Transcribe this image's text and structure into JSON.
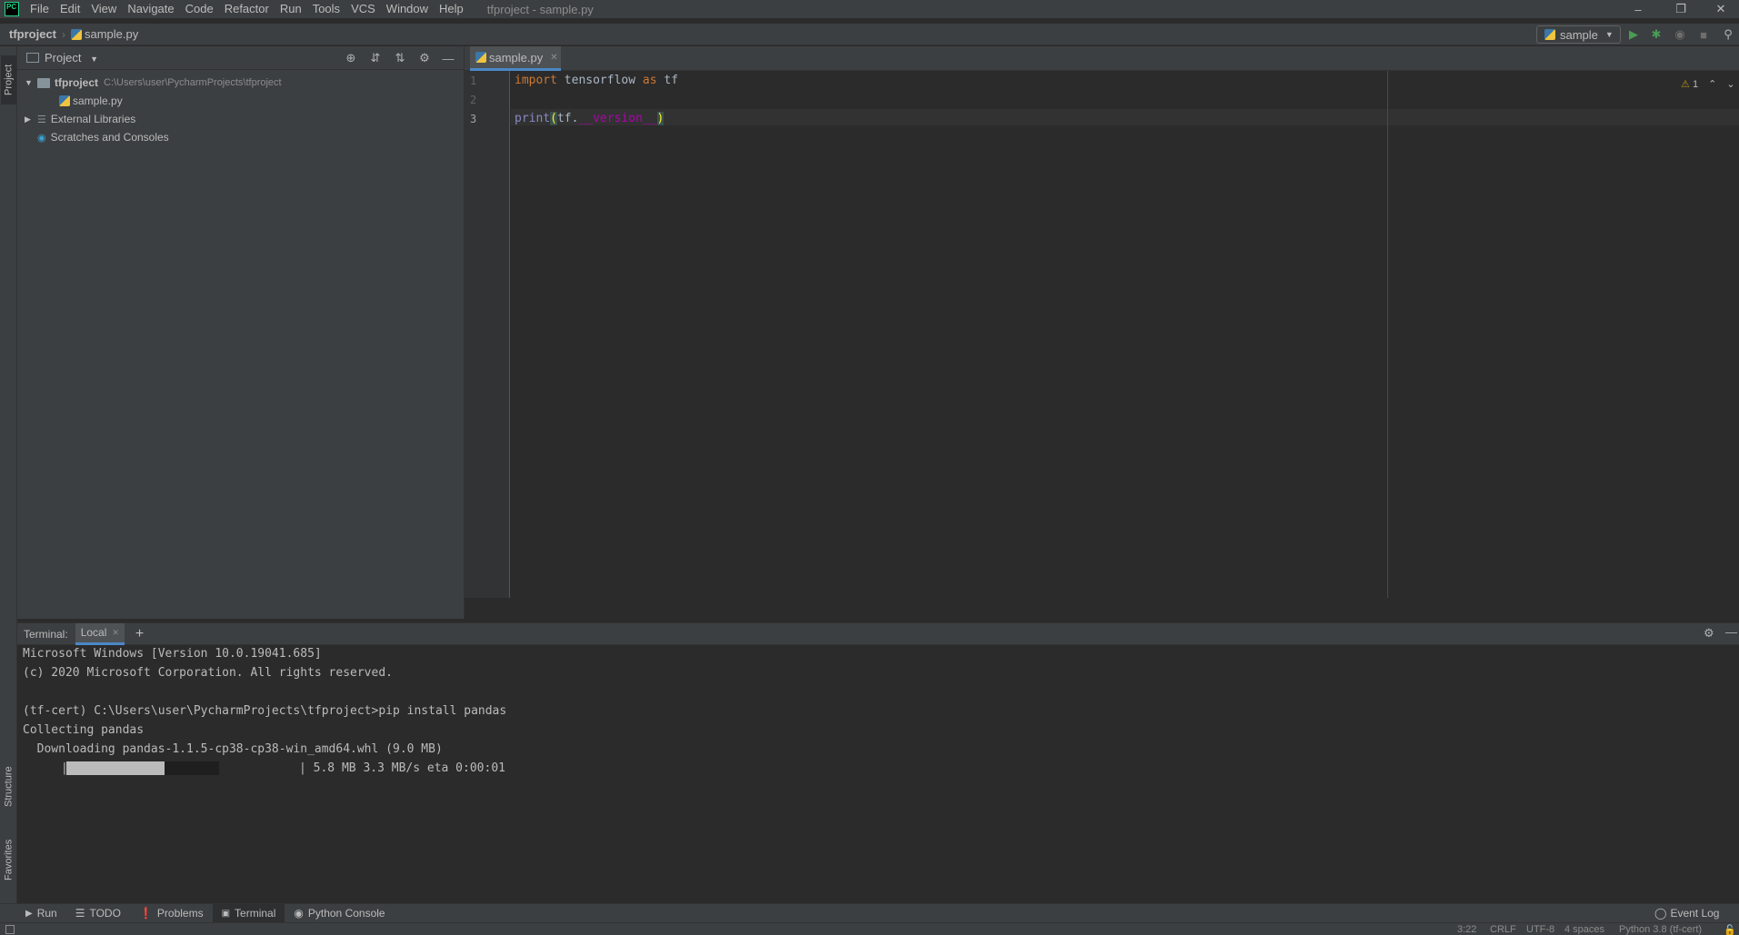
{
  "menubar": {
    "app_logo": "PC",
    "items": [
      "File",
      "Edit",
      "View",
      "Navigate",
      "Code",
      "Refactor",
      "Run",
      "Tools",
      "VCS",
      "Window",
      "Help"
    ],
    "window_title": "tfproject - sample.py"
  },
  "navbar": {
    "project": "tfproject",
    "file": "sample.py",
    "run_config": "sample"
  },
  "left_stripe": {
    "project_tab": "Project",
    "structure_tab": "Structure",
    "favorites_tab": "Favorites"
  },
  "project_panel": {
    "title": "Project",
    "tree": {
      "root_name": "tfproject",
      "root_path": "C:\\Users\\user\\PycharmProjects\\tfproject",
      "file": "sample.py",
      "external_libraries": "External Libraries",
      "scratches": "Scratches and Consoles"
    }
  },
  "editor": {
    "tab_label": "sample.py",
    "line_numbers": [
      "1",
      "2",
      "3"
    ],
    "line1": {
      "kw1": "import",
      "mid": " tensorflow ",
      "kw2": "as",
      "end": " tf"
    },
    "line3": {
      "fn": "print",
      "open": "(",
      "obj": "tf.",
      "attr": "__version__",
      "close": ")"
    },
    "warnings_count": "1"
  },
  "terminal": {
    "label": "Terminal:",
    "tab": "Local",
    "lines": [
      "Microsoft Windows [Version 10.0.19041.685]",
      "(c) 2020 Microsoft Corporation. All rights reserved.",
      "",
      "(tf-cert) C:\\Users\\user\\PycharmProjects\\tfproject>pip install pandas",
      "Collecting pandas",
      "  Downloading pandas-1.1.5-cp38-cp38-win_amd64.whl (9.0 MB)"
    ],
    "progress_text": "| 5.8 MB 3.3 MB/s eta 0:00:01",
    "progress_fraction": 0.64
  },
  "bottom_tools": {
    "run": "Run",
    "todo": "TODO",
    "problems": "Problems",
    "terminal": "Terminal",
    "python_console": "Python Console",
    "event_log": "Event Log"
  },
  "status_bar": {
    "position": "3:22",
    "line_sep": "CRLF",
    "encoding": "UTF-8",
    "indent": "4 spaces",
    "interpreter": "Python 3.8 (tf-cert)"
  },
  "colors": {
    "accent": "#4a88c7",
    "run_green": "#499c54",
    "keyword": "#cc7832",
    "dunder": "#b200b2"
  }
}
